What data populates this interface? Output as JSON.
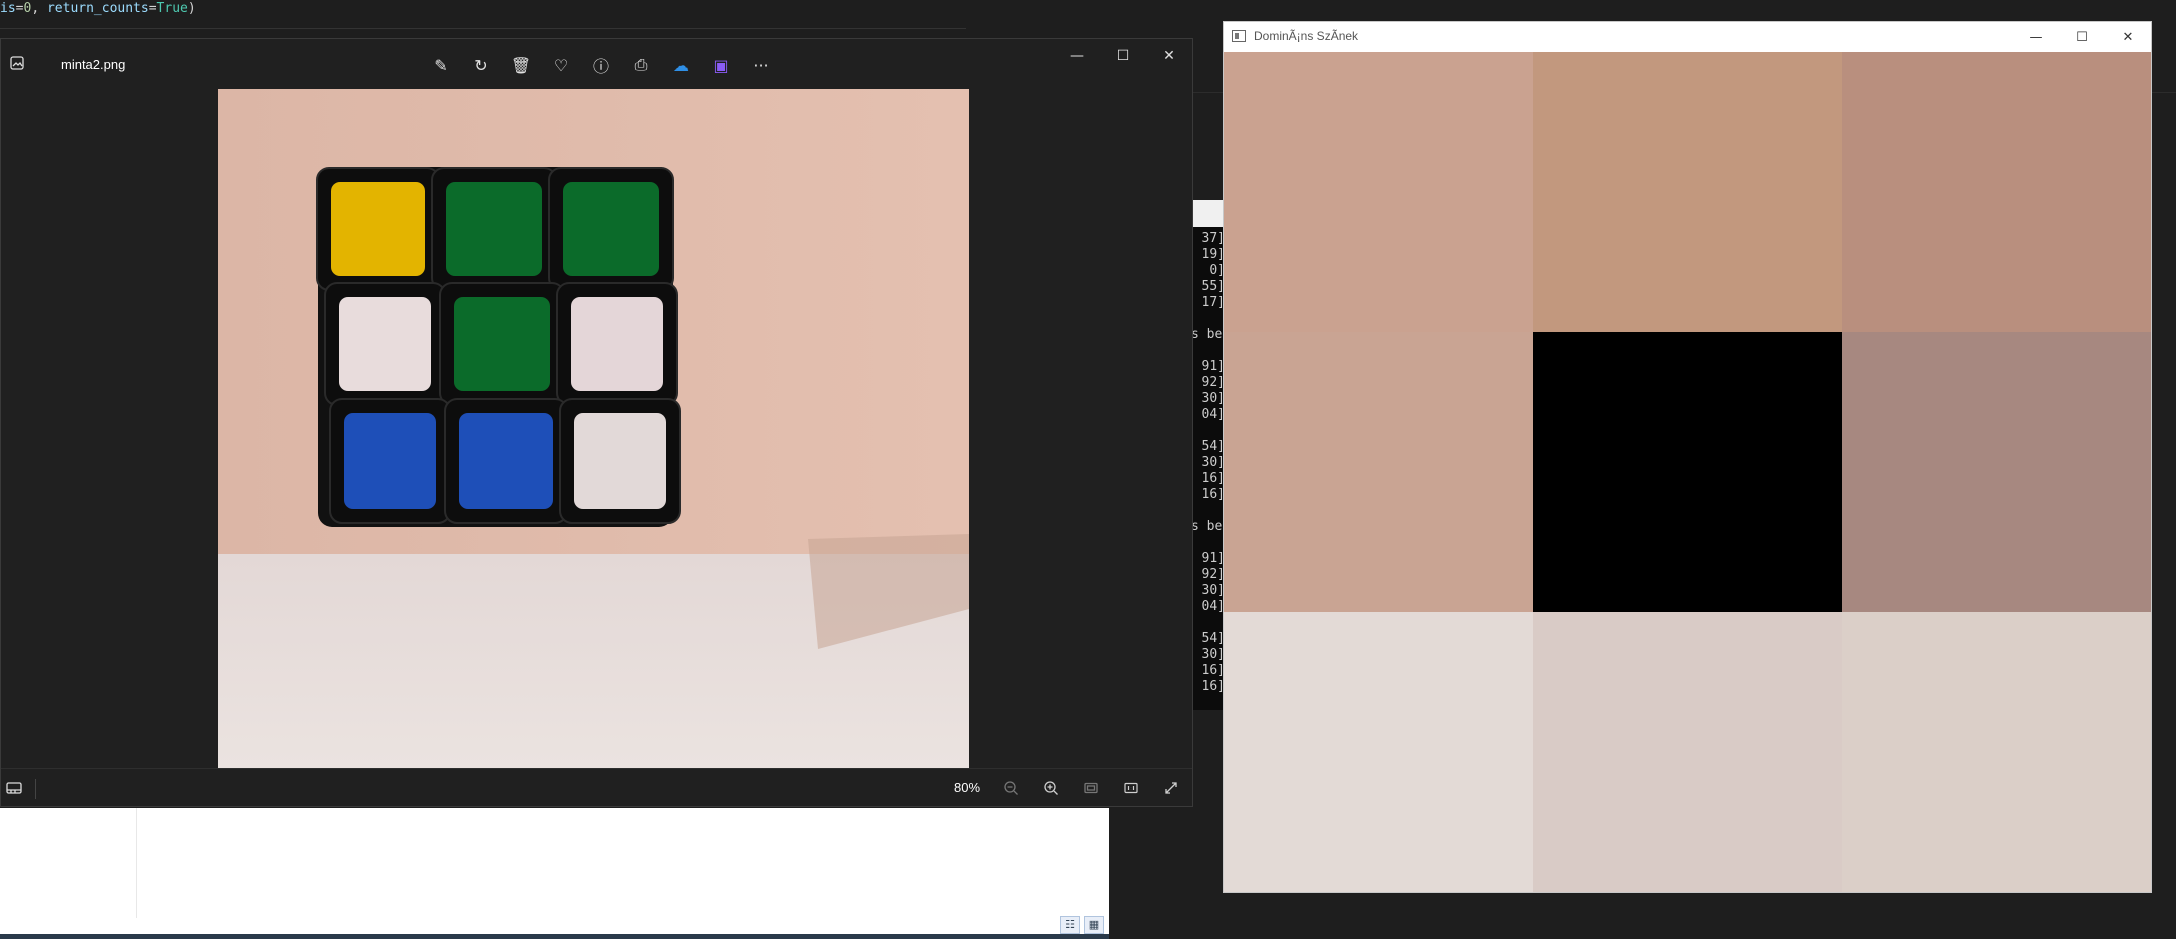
{
  "editor": {
    "code_line_parts": [
      {
        "cls": "k",
        "text": "is"
      },
      {
        "cls": "p",
        "text": "="
      },
      {
        "cls": "n",
        "text": "0"
      },
      {
        "cls": "p",
        "text": ", "
      },
      {
        "cls": "k",
        "text": "return_counts"
      },
      {
        "cls": "p",
        "text": "="
      },
      {
        "cls": "c",
        "text": "True"
      },
      {
        "cls": "p",
        "text": ")"
      }
    ]
  },
  "console": {
    "lines": [
      "37]",
      "19]",
      "0]",
      "55]",
      "17]",
      "",
      "s bea",
      "",
      "91]",
      "92]",
      "30]",
      "04]",
      "",
      "54]",
      "30]",
      "16]",
      "16]",
      "",
      "s bea",
      "",
      "91]",
      "92]",
      "30]",
      "04]",
      "",
      "54]",
      "30]",
      "16]",
      "16]"
    ]
  },
  "photos": {
    "filename": "minta2.png",
    "toolbar_icons": [
      "edit-image-icon",
      "rotate-icon",
      "delete-icon",
      "favorite-icon",
      "info-icon",
      "print-icon",
      "onedrive-icon",
      "clipchamp-icon",
      "more-icon"
    ],
    "toolbar_glyphs": [
      "✎",
      "↻",
      "🗑",
      "♡",
      "ⓘ",
      "⎙",
      "☁",
      "▣",
      "···"
    ],
    "window_controls": [
      "—",
      "☐",
      "✕"
    ],
    "zoom": "80%",
    "cube": {
      "background_top": "#dcb6a6",
      "background_floor": "#ebe3e0",
      "stickers": [
        [
          "#e3b400",
          "#0b6b2a",
          "#0b6b2a"
        ],
        [
          "#e8dcdc",
          "#0b6b2a",
          "#e4d6d8"
        ],
        [
          "#1e4fb8",
          "#1e4fb8",
          "#e2d9d8"
        ]
      ]
    }
  },
  "color_window": {
    "title": "DominÃ¡ns SzÃ­nek",
    "window_controls": [
      "—",
      "☐",
      "✕"
    ],
    "cells": [
      [
        "#caa290",
        "#c2987e",
        "#b98f7e"
      ],
      [
        "#c9a493",
        "#000000",
        "#a78880"
      ],
      [
        "#e3dad6",
        "#d9cbc6",
        "#dbcfc8"
      ]
    ]
  },
  "white_pane": {
    "view_icons": [
      "details-view-icon",
      "large-icons-view-icon"
    ]
  }
}
